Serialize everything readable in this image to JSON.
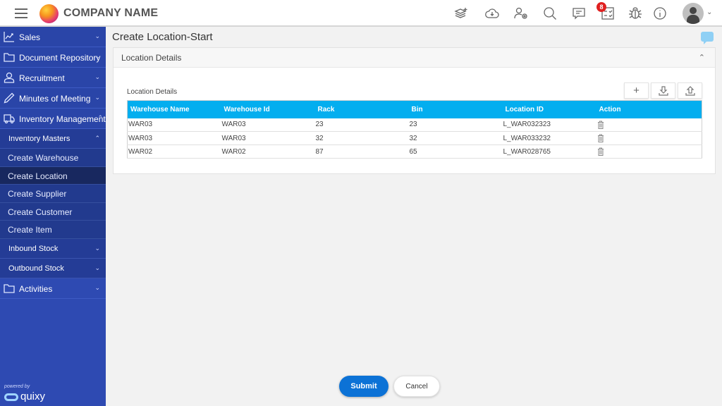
{
  "header": {
    "company_name": "COMPANY NAME",
    "notification_count": "8",
    "icons": [
      "layers-add-icon",
      "cloud-download-icon",
      "user-settings-icon",
      "search-icon",
      "chat-icon",
      "tasks-icon",
      "bug-icon",
      "info-icon"
    ]
  },
  "sidebar": {
    "items": [
      {
        "label": "Sales",
        "icon": "chart-icon"
      },
      {
        "label": "Document Repository",
        "icon": "folder-icon"
      },
      {
        "label": "Recruitment",
        "icon": "user-icon"
      },
      {
        "label": "Minutes of Meeting",
        "icon": "pen-icon"
      },
      {
        "label": "Inventory Management",
        "icon": "truck-icon"
      }
    ],
    "inventory_masters": {
      "label": "Inventory Masters",
      "items": [
        {
          "label": "Create Warehouse"
        },
        {
          "label": "Create Location",
          "active": true
        },
        {
          "label": "Create Supplier"
        },
        {
          "label": "Create Customer"
        },
        {
          "label": "Create Item"
        }
      ]
    },
    "inbound_stock": "Inbound Stock",
    "outbound_stock": "Outbound Stock",
    "activities": "Activities",
    "powered_by": "powered by",
    "brand": "quixy"
  },
  "main": {
    "page_title": "Create Location-Start",
    "section_title": "Location Details",
    "grid": {
      "title": "Location Details",
      "columns": [
        "Warehouse Name",
        "Warehouse Id",
        "Rack",
        "Bin",
        "Location ID",
        "Action"
      ],
      "rows": [
        [
          "WAR03",
          "WAR03",
          "23",
          "23",
          "L_WAR032323"
        ],
        [
          "WAR03",
          "WAR03",
          "32",
          "32",
          "L_WAR033232"
        ],
        [
          "WAR02",
          "WAR02",
          "87",
          "65",
          "L_WAR028765"
        ]
      ],
      "add_label": "+"
    }
  },
  "footer": {
    "submit_label": "Submit",
    "cancel_label": "Cancel"
  },
  "colors": {
    "sidebar": "#2e4ab2",
    "grid_header": "#03aeef",
    "submit": "#0c72d6",
    "badge": "#e02020"
  }
}
